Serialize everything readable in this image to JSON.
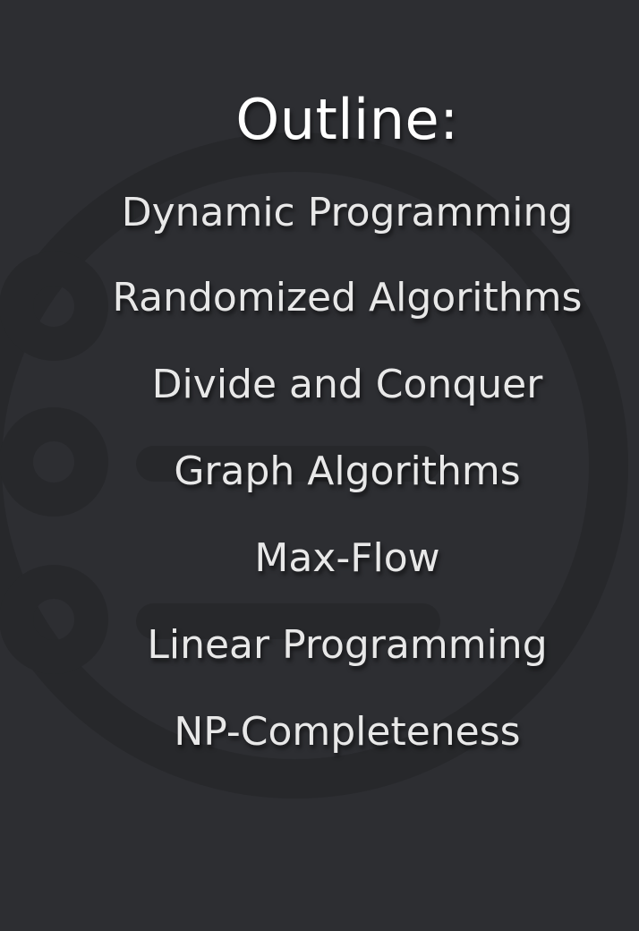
{
  "slide": {
    "title": "Outline:",
    "items": [
      "Dynamic Programming",
      "Randomized Algorithms",
      "Divide and Conquer",
      "Graph Algorithms",
      "Max-Flow",
      "Linear Programming",
      "NP-Completeness"
    ]
  },
  "colors": {
    "background": "#2d2e32",
    "decoration": "#27282b",
    "title_text": "#ffffff",
    "item_text": "#e8e8e8"
  }
}
